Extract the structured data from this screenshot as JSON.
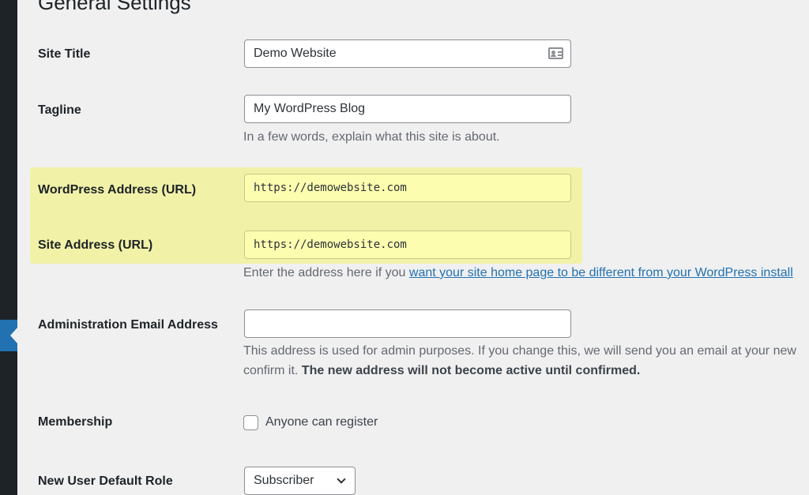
{
  "page": {
    "title": "General Settings"
  },
  "fields": {
    "site_title": {
      "label": "Site Title",
      "value": "Demo Website"
    },
    "tagline": {
      "label": "Tagline",
      "value": "My WordPress Blog",
      "description": "In a few words, explain what this site is about."
    },
    "wp_address": {
      "label": "WordPress Address (URL)",
      "value": "https://demowebsite.com"
    },
    "site_address": {
      "label": "Site Address (URL)",
      "value": "https://demowebsite.com",
      "description_prefix": "Enter the address here if you ",
      "description_link": "want your site home page to be different from your WordPress install"
    },
    "admin_email": {
      "label": "Administration Email Address",
      "value": "",
      "description_line1": "This address is used for admin purposes. If you change this, we will send you an email at your new",
      "description_line2_prefix": "confirm it. ",
      "description_line2_bold": "The new address will not become active until confirmed."
    },
    "membership": {
      "label": "Membership",
      "checkbox_label": "Anyone can register",
      "checked": false
    },
    "default_role": {
      "label": "New User Default Role",
      "selected": "Subscriber"
    }
  },
  "icons": {
    "site_title_field": "contact-card-icon",
    "role_select": "chevron-down-icon",
    "sidebar_current": "arrow-left-icon"
  },
  "colors": {
    "highlight": "#f1f2a8",
    "link": "#2271b1",
    "sidebar": "#1d2327",
    "background": "#f0f0f1"
  }
}
